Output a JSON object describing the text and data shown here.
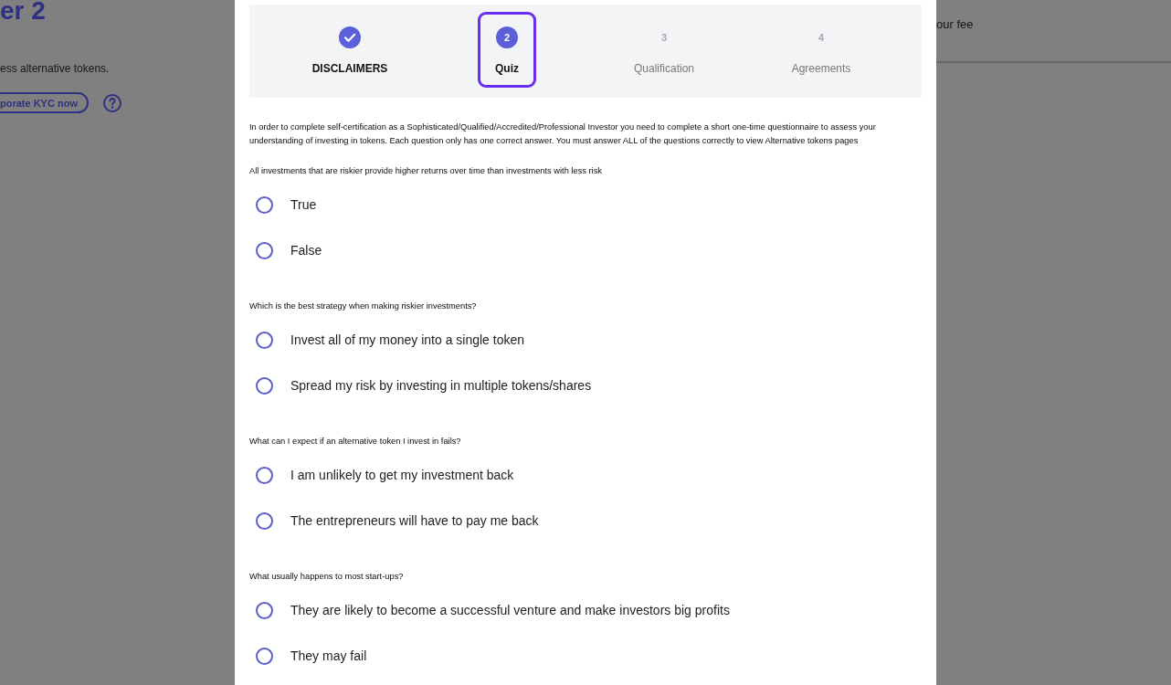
{
  "background_page": {
    "heading": "er 2",
    "description": "ess alternative tokens.",
    "kyc_button": "porate KYC now",
    "fee_text": "our fee"
  },
  "stepper": {
    "steps": [
      {
        "label": "DISCLAIMERS",
        "completed": true,
        "selected": false
      },
      {
        "number": "2",
        "label": "Quiz",
        "completed": false,
        "selected": true
      },
      {
        "number": "3",
        "label": "Qualification",
        "completed": false,
        "selected": false
      },
      {
        "number": "4",
        "label": "Agreements",
        "completed": false,
        "selected": false
      }
    ]
  },
  "intro": "In order to complete self-certification as a Sophisticated/Qualified/Accredited/Professional Investor you need to complete a short one-time questionnaire to assess your understanding of investing in tokens. Each question only has one correct answer. You must answer ALL of the questions correctly to view Alternative tokens pages",
  "questions": [
    {
      "text": "All investments that are riskier provide higher returns over time than investments with less risk",
      "options": [
        {
          "label": "True",
          "selected": false
        },
        {
          "label": "False",
          "selected": false
        }
      ]
    },
    {
      "text": "Which is the best strategy when making riskier investments?",
      "options": [
        {
          "label": "Invest all of my money into a single token",
          "selected": false
        },
        {
          "label": "Spread my risk by investing in multiple tokens/shares",
          "selected": false
        }
      ]
    },
    {
      "text": "What can I expect if an alternative token I invest in fails?",
      "options": [
        {
          "label": "I am unlikely to get my investment back",
          "selected": false
        },
        {
          "label": "The entrepreneurs will have to pay me back",
          "selected": false
        }
      ]
    },
    {
      "text": "What usually happens to most start-ups?",
      "options": [
        {
          "label": "They are likely to become a successful venture and make investors big profits",
          "selected": false
        },
        {
          "label": "They may fail",
          "selected": false
        }
      ]
    }
  ]
}
